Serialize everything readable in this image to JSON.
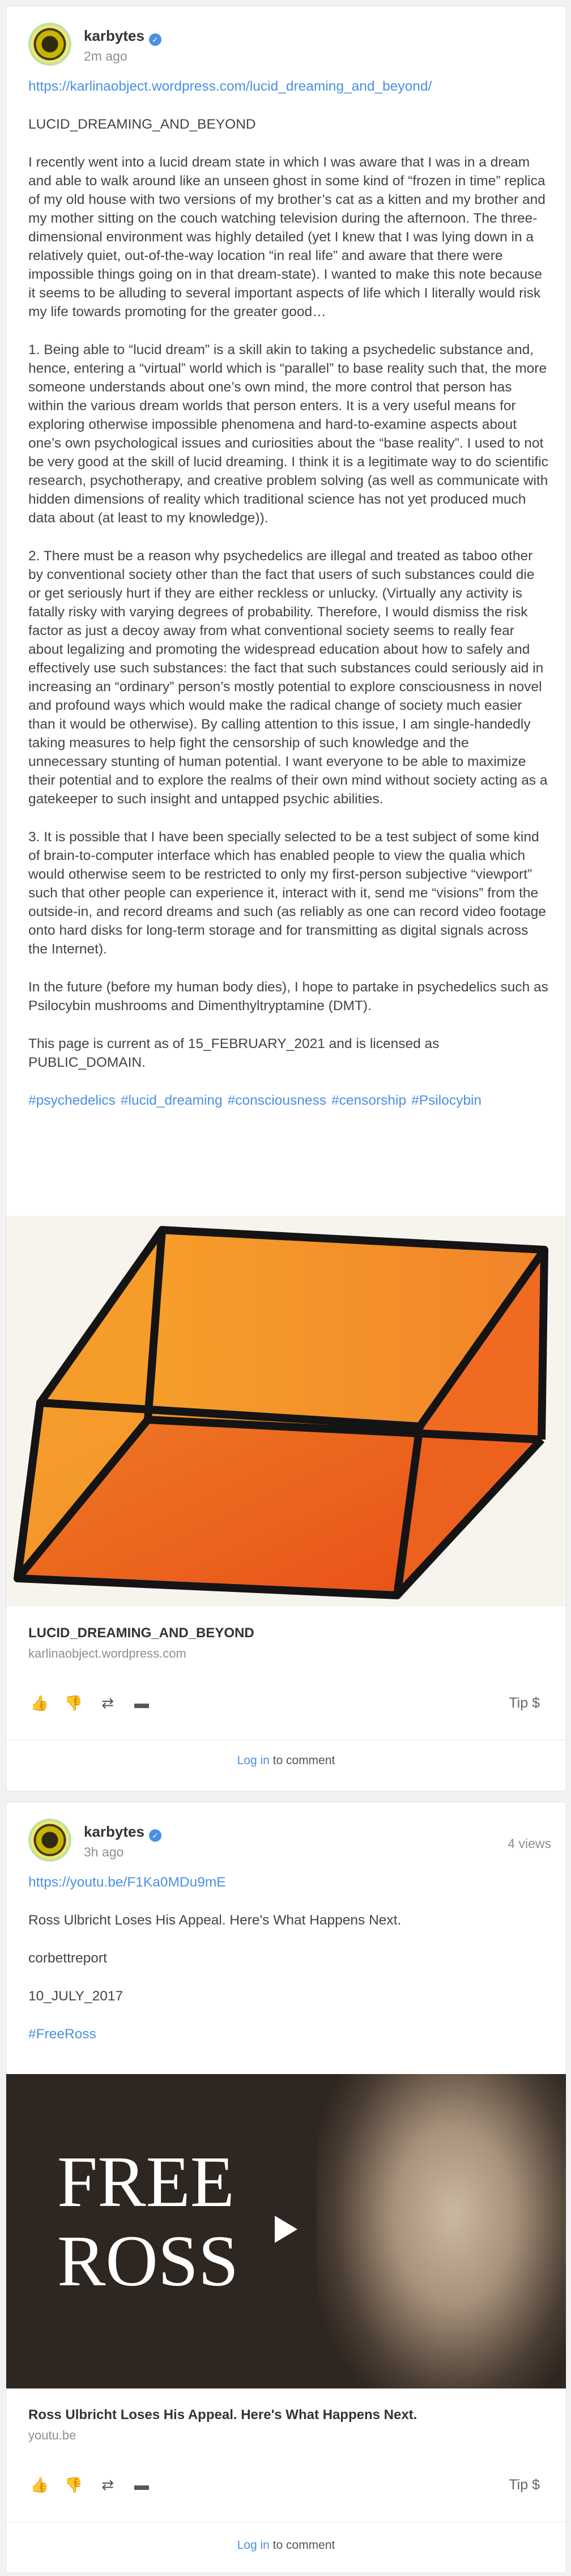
{
  "posts": [
    {
      "author": "karbytes",
      "time": "2m ago",
      "url": "https://karlinaobject.wordpress.com/lucid_dreaming_and_beyond/",
      "title": "LUCID_DREAMING_AND_BEYOND",
      "paragraphs": [
        "I recently went into a lucid dream state in which I was aware that I was in a dream and able to walk around like an unseen ghost in some kind of “frozen in time” replica of my old house with two versions of my brother’s cat as a kitten and my brother and my mother sitting on the couch watching television during the afternoon. The three-dimensional environment was highly detailed (yet I knew that I was lying down in a relatively quiet, out-of-the-way location “in real life” and aware that there were impossible things going on in that dream-state). I wanted to make this note because it seems to be alluding to several important aspects of life which I literally would risk my life towards promoting for the greater good…",
        "1. Being able to “lucid dream” is a skill akin to taking a psychedelic substance and, hence, entering a “virtual” world which is “parallel” to base reality such that, the more someone understands about one’s own mind, the more control that person has within the various dream worlds that person enters. It is a very useful means for exploring otherwise impossible phenomena and hard-to-examine aspects about one’s own psychological issues and curiosities about the “base reality”. I used to not be very good at the skill of lucid dreaming. I think it is a legitimate way to do scientific research, psychotherapy, and creative problem solving (as well as communicate with hidden dimensions of reality which traditional science has not yet produced much data about (at least to my knowledge)).",
        "2. There must be a reason why psychedelics are illegal and treated as taboo other by conventional society other than the fact that users of such substances could die or get seriously hurt if they are either reckless or unlucky. (Virtually any activity is fatally risky with varying degrees of probability. Therefore, I would dismiss the risk factor as just a decoy away from what conventional society seems to really fear about legalizing and promoting the widespread education about how to safely and effectively use such substances: the fact that such substances could seriously aid in increasing an “ordinary” person’s mostly potential to explore consciousness in novel and profound ways which would make the radical change of society much easier than it would be otherwise). By calling attention to this issue, I am single-handedly taking measures to help fight the censorship of such knowledge and the unnecessary stunting of human potential. I want everyone to be able to maximize their potential and to explore the realms of their own mind without society acting as a gatekeeper to such insight and untapped psychic abilities.",
        "3. It is possible that I have been specially selected to be a test subject of some kind of brain-to-computer interface which has enabled people to view the qualia which would otherwise seem to be restricted to only my first-person subjective “viewport” such that other people can experience it, interact with it, send me “visions” from the outside-in, and record dreams and such (as reliably as one can record video footage onto hard disks for long-term storage and for transmitting as digital signals across the Internet).",
        "In the future (before my human body dies), I hope to partake in psychedelics such as Psilocybin mushrooms and Dimenthyltryptamine (DMT).",
        "This page is current as of 15_FEBRUARY_2021 and is licensed as PUBLIC_DOMAIN."
      ],
      "tags": [
        "#psychedelics",
        "#lucid_dreaming",
        "#consciousness",
        "#censorship",
        "#Psilocybin"
      ],
      "link_title": "LUCID_DREAMING_AND_BEYOND",
      "link_domain": "karlinaobject.wordpress.com",
      "tip_label": "Tip $",
      "login_label": "Log in",
      "comment_suffix": " to comment"
    },
    {
      "author": "karbytes",
      "time": "3h ago",
      "views": "4 views",
      "url": "https://youtu.be/F1Ka0MDu9mE",
      "lines": [
        "Ross Ulbricht Loses His Appeal. Here's What Happens Next.",
        "corbettreport",
        "10_JULY_2017"
      ],
      "tags": [
        "#FreeRoss"
      ],
      "thumbnail_text": [
        "FREE",
        "ROSS"
      ],
      "link_title": "Ross Ulbricht Loses His Appeal. Here's What Happens Next.",
      "link_domain": "youtu.be",
      "tip_label": "Tip $",
      "login_label": "Log in",
      "comment_suffix": " to comment"
    }
  ],
  "colors": {
    "link": "#4a90e2",
    "verified": "#4a90e2",
    "cube_orange": "#f5901e"
  },
  "icons": [
    "verified-icon",
    "thumbs-up-icon",
    "thumbs-down-icon",
    "repost-icon",
    "comment-icon",
    "play-icon"
  ]
}
